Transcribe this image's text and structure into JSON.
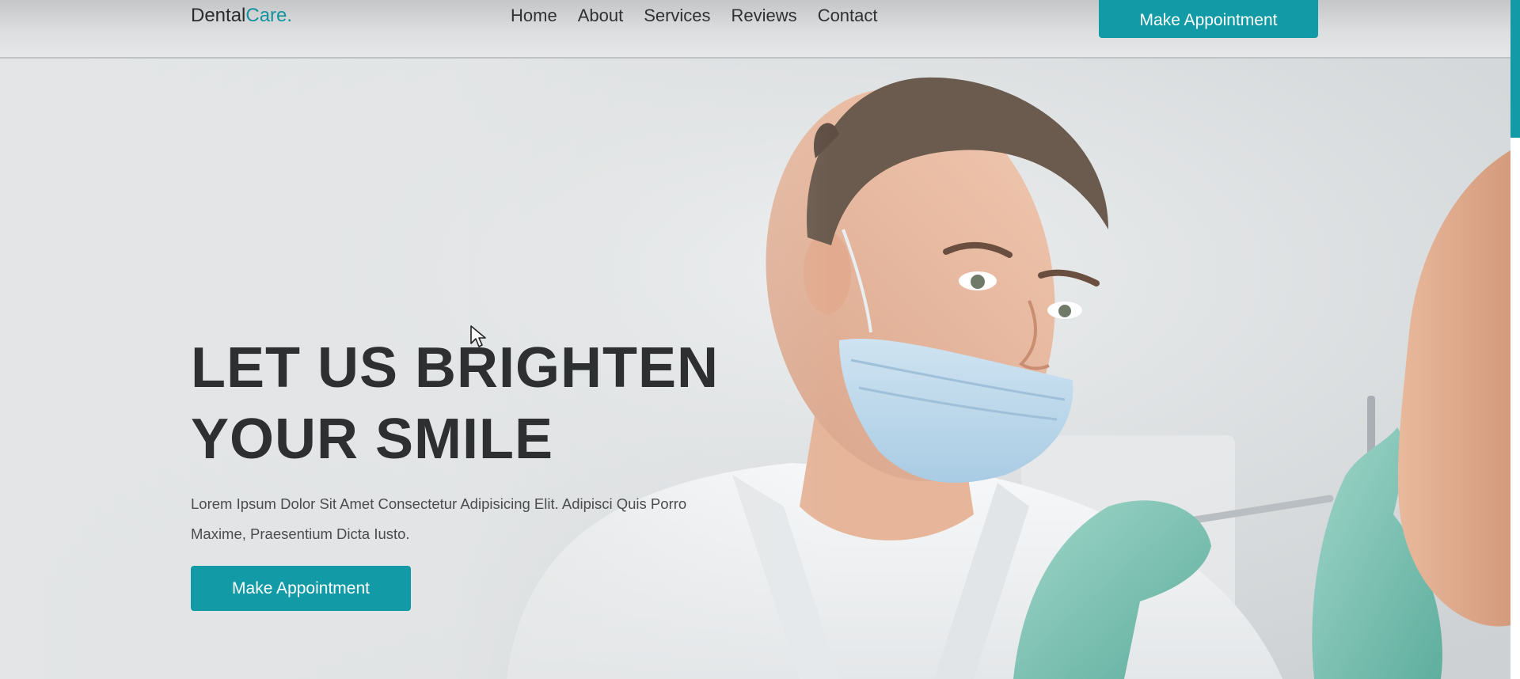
{
  "brand": {
    "name_part1": "Dental",
    "name_part2": "Care.",
    "accent_color": "#129ba6"
  },
  "nav": {
    "items": [
      {
        "label": "Home"
      },
      {
        "label": "About"
      },
      {
        "label": "Services"
      },
      {
        "label": "Reviews"
      },
      {
        "label": "Contact"
      }
    ],
    "cta_label": "Make Appointment"
  },
  "hero": {
    "title_line1": "LET US BRIGHTEN",
    "title_line2": "YOUR SMILE",
    "description": "Lorem Ipsum Dolor Sit Amet Consectetur Adipisicing Elit. Adipisci Quis Porro Maxime, Praesentium Dicta Iusto.",
    "cta_label": "Make Appointment",
    "image_subject": "dentist-with-patient-photo"
  },
  "icons": {
    "cursor": "mouse-pointer-icon"
  }
}
